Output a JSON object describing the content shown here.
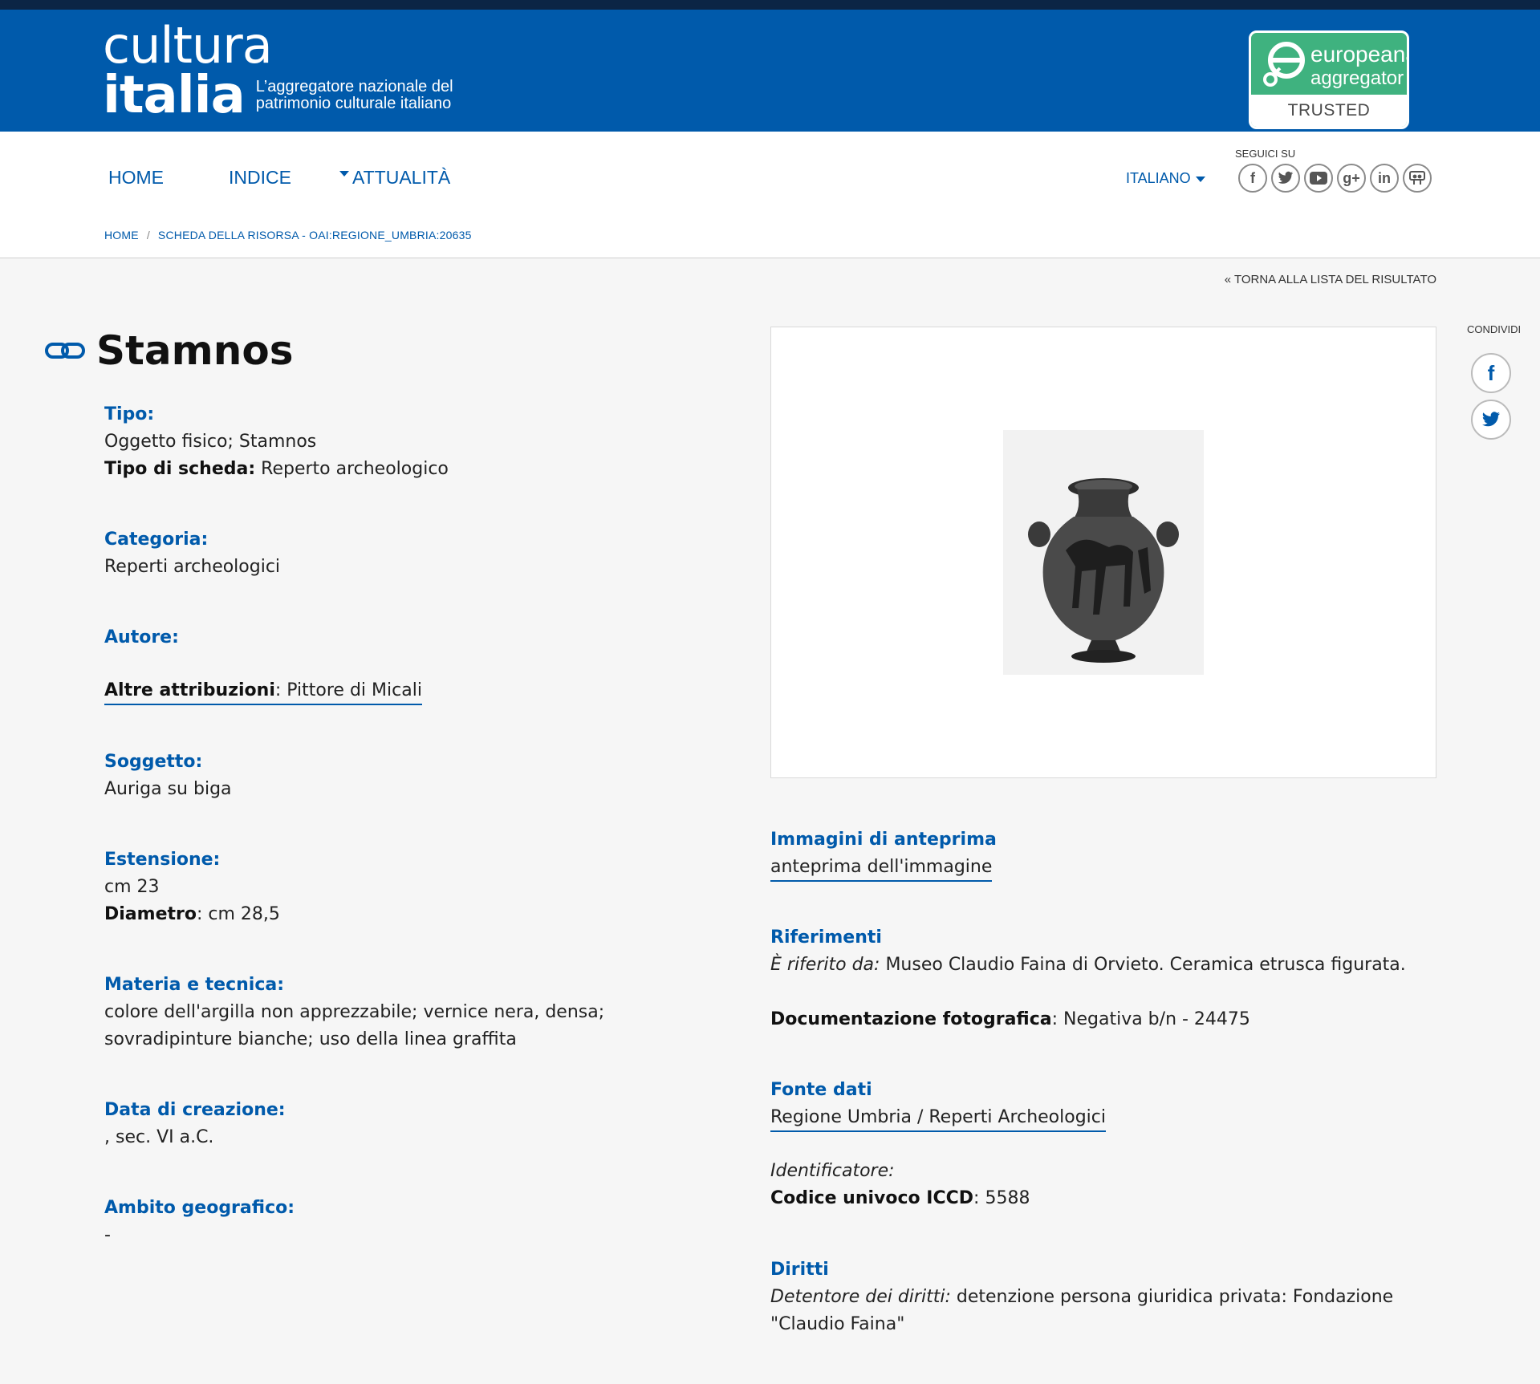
{
  "header": {
    "logo_line1": "cultura",
    "logo_line2": "italia",
    "logo_tagline_1": "L’aggregatore nazionale del",
    "logo_tagline_2": "patrimonio culturale italiano",
    "europeana_line1": "europeana",
    "europeana_line2": "aggregator",
    "europeana_badge": "TRUSTED PARTNER",
    "brand_color": "#005aab",
    "europeana_color": "#3fb27f"
  },
  "nav": {
    "items": [
      "HOME",
      "INDICE",
      "ATTUALITÀ"
    ],
    "language": "ITALIANO",
    "follow_label": "SEGUICI SU",
    "social": [
      "f",
      "t",
      "▶",
      "g+",
      "in",
      "ss"
    ]
  },
  "breadcrumb": {
    "home": "HOME",
    "current": "SCHEDA DELLA RISORSA - OAI:REGIONE_UMBRIA:20635"
  },
  "back_link": "« TORNA ALLA LISTA DEL RISULTATO",
  "title": "Stamnos",
  "left": {
    "tipo_label": "Tipo:",
    "tipo_value": "Oggetto fisico; Stamnos",
    "tipo_scheda_label": "Tipo di scheda:",
    "tipo_scheda_value": "Reperto archeologico",
    "categoria_label": "Categoria:",
    "categoria_value": "Reperti archeologici",
    "autore_label": "Autore:",
    "altre_attribuzioni_label": "Altre attribuzioni",
    "altre_attribuzioni_value": "Pittore di Micali",
    "soggetto_label": "Soggetto:",
    "soggetto_value": "Auriga su biga",
    "estensione_label": "Estensione:",
    "estensione_value": "cm 23",
    "diametro_label": "Diametro",
    "diametro_value": "cm 28,5",
    "materia_label": "Materia e tecnica:",
    "materia_value": "colore dell'argilla non apprezzabile; vernice nera, densa; sovradipinture bianche; uso della linea graffita",
    "data_label": "Data di creazione:",
    "data_value": ", sec. VI a.C.",
    "ambito_label": "Ambito geografico:",
    "ambito_value": "-"
  },
  "right": {
    "anteprima_label": "Immagini di anteprima",
    "anteprima_link": "anteprima dell'immagine",
    "riferimenti_label": "Riferimenti",
    "riferito_label": "È riferito da:",
    "riferito_value": "Museo Claudio Faina di Orvieto. Ceramica etrusca figurata.",
    "docfoto_label": "Documentazione fotografica",
    "docfoto_value": "Negativa b/n - 24475",
    "fonte_label": "Fonte dati",
    "fonte_link": "Regione Umbria / Reperti Archeologici",
    "identificatore_label": "Identificatore:",
    "iccd_label": "Codice univoco ICCD",
    "iccd_value": "5588",
    "diritti_label": "Diritti",
    "detentore_label": "Detentore dei diritti:",
    "detentore_value": "detenzione persona giuridica privata: Fondazione \"Claudio Faina\""
  },
  "share": {
    "label": "CONDIVIDI",
    "facebook": "f",
    "twitter": "t"
  }
}
